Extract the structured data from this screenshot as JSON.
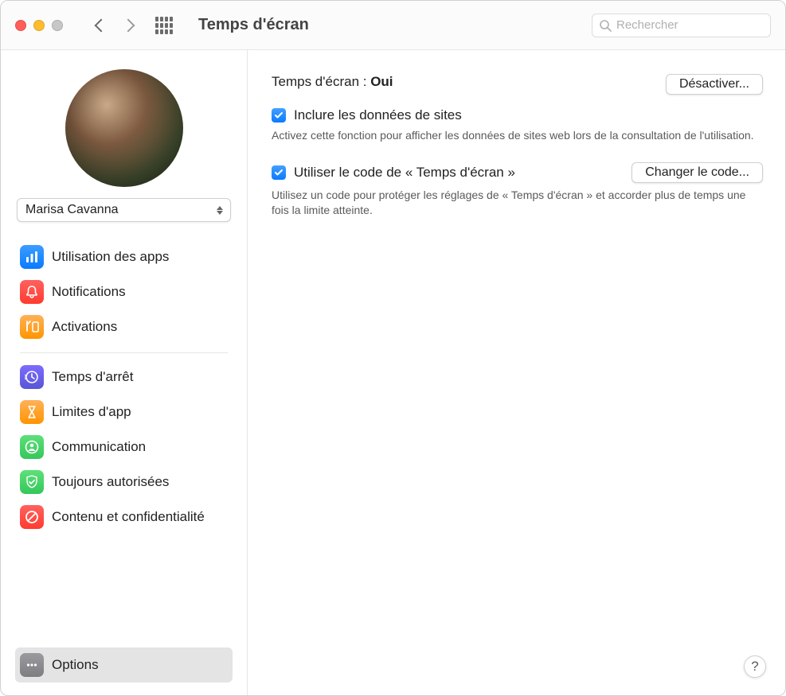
{
  "window": {
    "title": "Temps d'écran"
  },
  "search": {
    "placeholder": "Rechercher"
  },
  "user": {
    "name": "Marisa Cavanna"
  },
  "sidebar": {
    "group1": [
      {
        "label": "Utilisation des apps",
        "icon": "bar-chart-icon",
        "color": "blue"
      },
      {
        "label": "Notifications",
        "icon": "bell-icon",
        "color": "red"
      },
      {
        "label": "Activations",
        "icon": "pickup-icon",
        "color": "orange"
      }
    ],
    "group2": [
      {
        "label": "Temps d'arrêt",
        "icon": "clock-icon",
        "color": "purple"
      },
      {
        "label": "Limites d'app",
        "icon": "hourglass-icon",
        "color": "orange"
      },
      {
        "label": "Communication",
        "icon": "person-circle-icon",
        "color": "green"
      },
      {
        "label": "Toujours autorisées",
        "icon": "check-shield-icon",
        "color": "green"
      },
      {
        "label": "Contenu et confidentialité",
        "icon": "no-entry-icon",
        "color": "redno"
      }
    ],
    "options": {
      "label": "Options",
      "icon": "ellipsis-icon",
      "color": "grey"
    }
  },
  "main": {
    "status_label": "Temps d'écran :",
    "status_value": "Oui",
    "disable_button": "Désactiver...",
    "include_sites": {
      "label": "Inclure les données de sites",
      "desc": "Activez cette fonction pour afficher les données de sites web lors de la consultation de l'utilisation.",
      "checked": true
    },
    "use_passcode": {
      "label": "Utiliser le code de « Temps d'écran »",
      "desc": "Utilisez un code pour protéger les réglages de « Temps d'écran » et accorder plus de temps une fois la limite atteinte.",
      "checked": true,
      "change_button": "Changer le code..."
    }
  },
  "help": {
    "label": "?"
  }
}
